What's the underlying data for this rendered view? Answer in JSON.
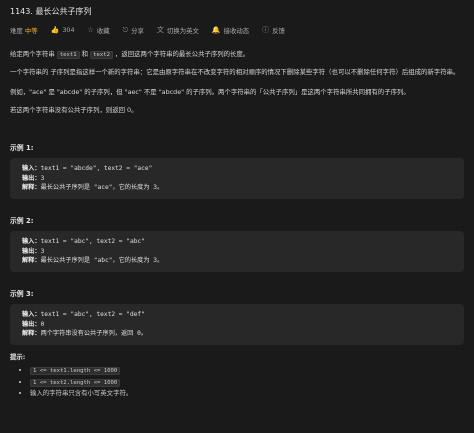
{
  "problem": {
    "title": "1143. 最长公共子序列",
    "difficulty_label": "难度",
    "difficulty": "中等",
    "likes": "304",
    "actions": {
      "favorite": "收藏",
      "share": "分享",
      "lang": "切换为英文",
      "notify": "接收动态",
      "feedback": "反馈"
    }
  },
  "description": {
    "p1_pre": "给定两个字符串",
    "p1_code1": "text1",
    "p1_and": "和",
    "p1_code2": "text2",
    "p1_post": "，返回这两个字符串的最长公共子序列的长度。",
    "p2": "一个字符串的 子序列是指这样一个新的字符串：它是由原字符串在不改变字符的相对顺序的情况下删除某些字符（也可以不删除任何字符）后组成的新字符串。",
    "p3": "例如，\"ace\" 是 \"abcde\" 的子序列，但 \"aec\" 不是 \"abcde\" 的子序列。两个字符串的「公共子序列」是这两个字符串所共同拥有的子序列。",
    "p4": "若这两个字符串没有公共子序列，则返回 0。"
  },
  "examples": [
    {
      "title": "示例 1:",
      "input_label": "输入：",
      "input": "text1 = \"abcde\", text2 = \"ace\"",
      "output_label": "输出：",
      "output": "3",
      "explain_label": "解释：",
      "explain": "最长公共子序列是 \"ace\"，它的长度为 3。"
    },
    {
      "title": "示例 2:",
      "input_label": "输入：",
      "input": "text1 = \"abc\", text2 = \"abc\"",
      "output_label": "输出：",
      "output": "3",
      "explain_label": "解释：",
      "explain": "最长公共子序列是 \"abc\"，它的长度为 3。"
    },
    {
      "title": "示例 3:",
      "input_label": "输入：",
      "input": "text1 = \"abc\", text2 = \"def\"",
      "output_label": "输出：",
      "output": "0",
      "explain_label": "解释：",
      "explain": "两个字符串没有公共子序列，返回 0。"
    }
  ],
  "hints": {
    "title": "提示:",
    "items": [
      "1 <= text1.length <= 1000",
      "1 <= text2.length <= 1000",
      "输入的字符串只含有小写英文字符。"
    ]
  }
}
